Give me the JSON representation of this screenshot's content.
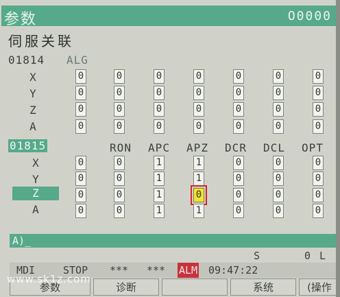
{
  "titlebar": {
    "screen": "参数",
    "program_no": "O0000"
  },
  "heading": "伺服关联",
  "param_1814": {
    "number": "01814",
    "name": "ALG",
    "axes": [
      "X",
      "Y",
      "Z",
      "A"
    ],
    "rows": [
      [
        "0",
        "0",
        "0",
        "0",
        "0",
        "0",
        "0"
      ],
      [
        "0",
        "0",
        "0",
        "0",
        "0",
        "0",
        "0"
      ],
      [
        "0",
        "0",
        "0",
        "0",
        "0",
        "0",
        "0"
      ],
      [
        "0",
        "0",
        "0",
        "0",
        "0",
        "0",
        "0"
      ]
    ]
  },
  "param_1815": {
    "number": "01815",
    "columns": [
      "RON",
      "APC",
      "APZ",
      "DCR",
      "DCL",
      "OPT"
    ],
    "axes": [
      "X",
      "Y",
      "Z",
      "A"
    ],
    "rows": [
      [
        "0",
        "0",
        "1",
        "1",
        "0",
        "0",
        "0"
      ],
      [
        "0",
        "0",
        "1",
        "1",
        "0",
        "0",
        "0"
      ],
      [
        "0",
        "0",
        "1",
        "0",
        "0",
        "0",
        "0"
      ],
      [
        "0",
        "0",
        "1",
        "1",
        "0",
        "0",
        "0"
      ]
    ]
  },
  "input_line": "A)_",
  "status": {
    "s_label": "S",
    "ol_label": "0 L"
  },
  "mode_bar": {
    "mode": "MDI",
    "state": "STOP",
    "stars1": "***",
    "stars2": "***",
    "alarm": "ALM",
    "time": "09:47:22"
  },
  "softkeys": [
    "参数",
    "诊断",
    "",
    "系统",
    "(操作"
  ],
  "watermark": "www.sk1z.com"
}
